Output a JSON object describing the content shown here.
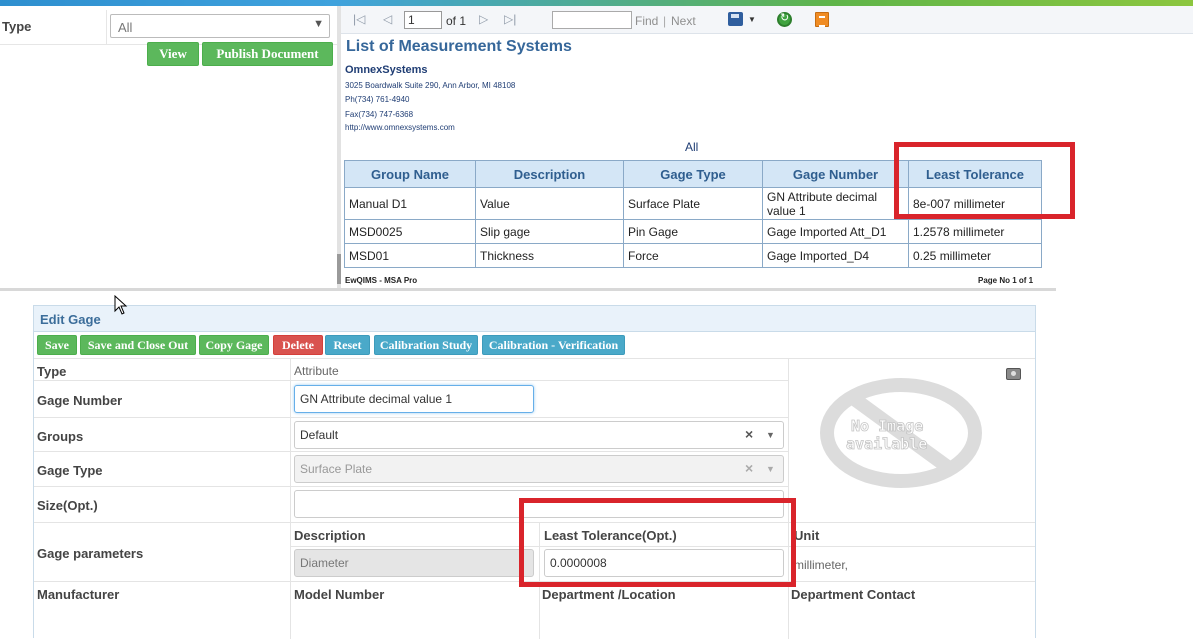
{
  "filter": {
    "type_label": "Type",
    "type_value": "All",
    "view_button": "View",
    "publish_button": "Publish Document"
  },
  "report_toolbar": {
    "page_value": "1",
    "of_label": "of 1",
    "find_label": "Find",
    "separator": "|",
    "next_label": "Next",
    "icons": [
      "first-page-icon",
      "previous-page-icon",
      "next-page-icon",
      "last-page-icon",
      "export-save-icon",
      "refresh-icon",
      "document-map-icon"
    ]
  },
  "report": {
    "title": "List of Measurement Systems",
    "company": "OmnexSystems",
    "address": "3025 Boardwalk Suite 290, Ann Arbor, MI 48108",
    "phone": "Ph(734) 761-4940",
    "fax": "Fax(734) 747-6368",
    "website": "http://www.omnexsystems.com",
    "filter_caption": "All",
    "columns": [
      "Group Name",
      "Description",
      "Gage Type",
      "Gage Number",
      "Least Tolerance"
    ],
    "rows": [
      [
        "Manual D1",
        "Value",
        "Surface Plate",
        "GN Attribute decimal value 1",
        "8e-007 millimeter"
      ],
      [
        "MSD0025",
        "Slip gage",
        "Pin Gage",
        "Gage Imported Att_D1",
        "1.2578 millimeter"
      ],
      [
        "MSD01",
        "Thickness",
        "Force",
        "Gage Imported_D4",
        "0.25 millimeter"
      ]
    ],
    "footer_left": "EwQIMS - MSA Pro",
    "footer_right": "Page No 1 of 1"
  },
  "edit_gage": {
    "header": "Edit Gage",
    "buttons": {
      "save": "Save",
      "save_close": "Save and Close Out",
      "copy": "Copy Gage",
      "delete": "Delete",
      "reset": "Reset",
      "calibration_study": "Calibration Study",
      "calibration_verification": "Calibration - Verification"
    },
    "type_label": "Type",
    "type_value": "Attribute",
    "gage_number_label": "Gage Number",
    "gage_number_value": "GN Attribute decimal value 1",
    "groups_label": "Groups",
    "groups_value": "Default",
    "gage_type_label": "Gage Type",
    "gage_type_value": "Surface Plate",
    "size_label": "Size(Opt.)",
    "size_value": "",
    "gage_params_label": "Gage parameters",
    "param_headers": {
      "description": "Description",
      "least_tolerance": "Least Tolerance(Opt.)",
      "unit": "Unit"
    },
    "param_values": {
      "description": "Diameter",
      "least_tolerance": "0.0000008",
      "unit": "millimeter,"
    },
    "bottom_labels": {
      "manufacturer": "Manufacturer",
      "model_number": "Model Number",
      "department_location": "Department /Location",
      "department_contact": "Department Contact"
    },
    "no_image_line1": "No Image",
    "no_image_line2": "available",
    "clear_symbol": "×",
    "dropdown_symbol": "▼"
  },
  "colors": {
    "accent_green": "#5cb85c",
    "danger_red": "#d9534f",
    "info_blue": "#4aa9c9",
    "highlight_red": "#d9242b",
    "report_header_bg": "#d4e6f6",
    "title_blue": "#36679a"
  }
}
